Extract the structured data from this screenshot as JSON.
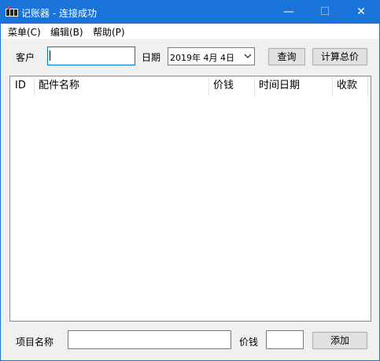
{
  "window": {
    "title": "记账器 - 连接成功",
    "controls": {
      "minimize": "—",
      "maximize": "☐",
      "close": "✕"
    }
  },
  "menu": [
    {
      "label": "菜单(C)"
    },
    {
      "label": "编辑(B)"
    },
    {
      "label": "帮助(P)"
    }
  ],
  "filter": {
    "customer_label": "客户",
    "customer_value": "",
    "date_label": "日期",
    "date_value": "2019年 4月 4日",
    "query_button": "查询",
    "total_button": "计算总价"
  },
  "list": {
    "columns": [
      "ID",
      "配件名称",
      "价钱",
      "时间日期",
      "收款"
    ],
    "rows": []
  },
  "add_form": {
    "item_name_label": "项目名称",
    "item_name_value": "",
    "price_label": "价钱",
    "price_value": "",
    "add_button": "添加"
  },
  "icons": {
    "app": "ledger-app-icon",
    "dropdown": "chevron-down-icon"
  },
  "colors": {
    "titlebar": "#1a73d9",
    "window_bg": "#f0f0f0",
    "button_bg": "#e1e1e1"
  }
}
